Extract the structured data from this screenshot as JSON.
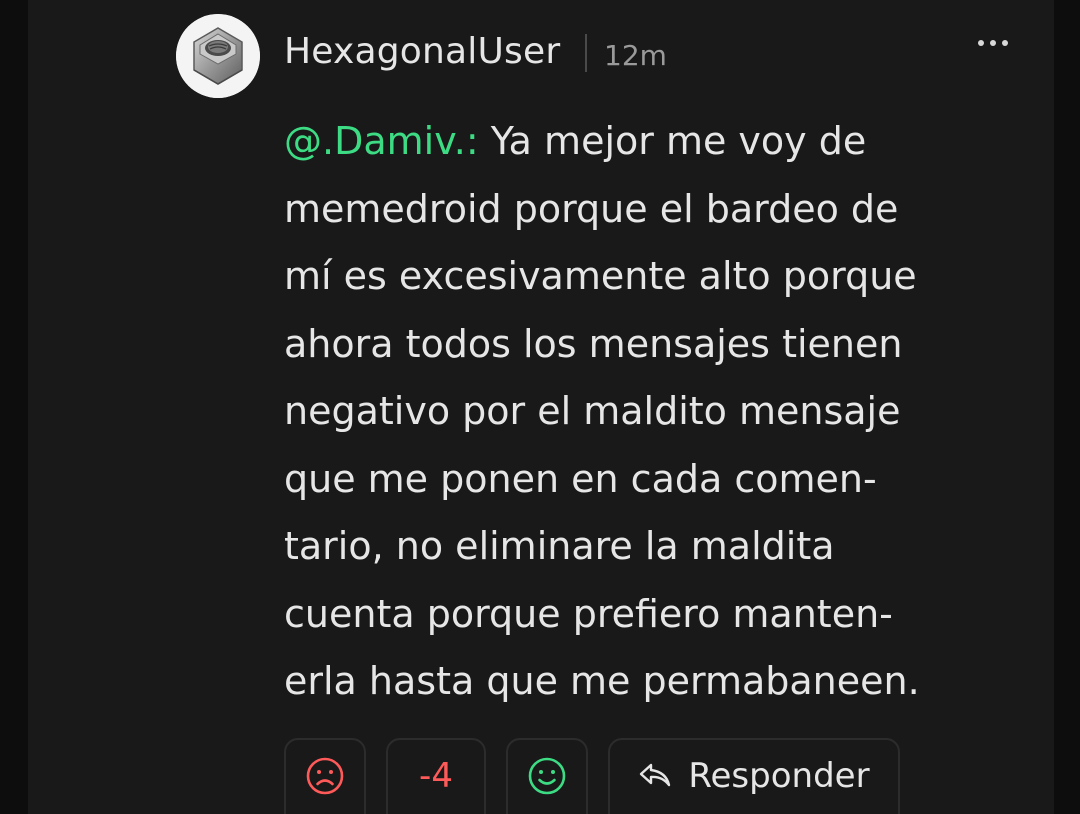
{
  "comment": {
    "author": "HexagonalUser",
    "time": "12m",
    "avatar_icon": "hex-nut-icon",
    "more_icon": "more-options-icon",
    "mention": "@.Damiv.:",
    "lines": [
      " Ya mejor me voy de",
      "memedroid porque el bardeo de",
      "mí es excesivamente alto porque",
      "ahora todos los mensajes tienen",
      "negativo por el maldito mensaje",
      "que me ponen en cada comen-",
      "tario, no eliminare la maldita",
      "cuenta porque prefiero manten-",
      "erla hasta que me permabaneen."
    ]
  },
  "actions": {
    "downvote_icon": "sad-face-icon",
    "score": "-4",
    "upvote_icon": "happy-face-icon",
    "reply_icon": "reply-arrow-icon",
    "reply_label": "Responder"
  },
  "colors": {
    "background": "#191919",
    "mention": "#3ddc84",
    "negative": "#ff5a5a",
    "positive": "#3ddc84",
    "text": "#e6e6e6",
    "muted": "#9a9a9a"
  }
}
